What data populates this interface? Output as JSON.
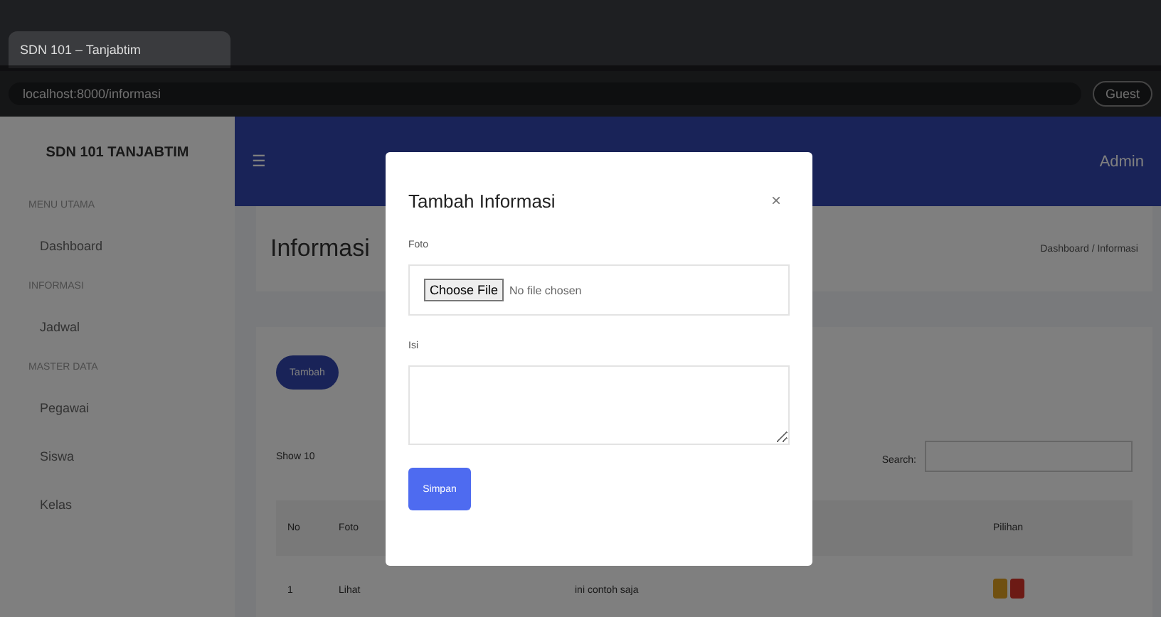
{
  "browser": {
    "tab_title": "SDN 101 – Tanjabtim",
    "url": "localhost:8000/informasi",
    "profile": "Guest"
  },
  "sidebar": {
    "brand": "SDN 101 TANJABTIM",
    "sections": [
      {
        "heading": "MENU UTAMA",
        "items": [
          {
            "label": "Dashboard",
            "selected": false
          }
        ]
      },
      {
        "heading": "INFORMASI",
        "items": [
          {
            "label": "Jadwal",
            "selected": false
          }
        ]
      },
      {
        "heading": "MASTER DATA",
        "items": [
          {
            "label": "Pegawai",
            "selected": false
          },
          {
            "label": "Siswa",
            "selected": false
          },
          {
            "label": "Kelas",
            "selected": false
          }
        ]
      }
    ]
  },
  "topbar": {
    "menu_icon": "☰",
    "user": "Admin"
  },
  "page": {
    "title": "Informasi",
    "breadcrumb": "Dashboard / Informasi"
  },
  "card": {
    "add_button": "Tambah",
    "show_label": "Show",
    "page_size": "10",
    "search_label": "Search:",
    "columns": [
      "No",
      "Foto",
      "Pilihan"
    ],
    "rows": [
      {
        "no": "1",
        "foto": "Lihat",
        "isi": "ini contoh saja"
      }
    ]
  },
  "modal": {
    "title": "Tambah Informasi",
    "close": "×",
    "fields": [
      {
        "kind": "file",
        "label": "Foto",
        "button": "Choose File",
        "value": "No file chosen"
      },
      {
        "kind": "textarea",
        "label": "Isi"
      }
    ],
    "submit": "Simpan"
  }
}
